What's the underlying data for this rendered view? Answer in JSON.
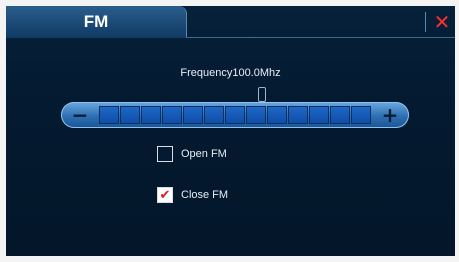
{
  "tab": {
    "title": "FM"
  },
  "window": {
    "close_glyph": "✕"
  },
  "frequency": {
    "label": "Frequency100.0Mhz",
    "value_mhz": 100.0
  },
  "slider": {
    "minus_glyph": "−",
    "plus_glyph": "+",
    "segments": 13,
    "icons": [
      "minus-icon",
      "plus-icon"
    ]
  },
  "options": [
    {
      "label": "Open FM",
      "checked": false
    },
    {
      "label": "Close FM",
      "checked": true
    }
  ],
  "colors": {
    "accent": "#2d6fb2",
    "close": "#ff2d2d",
    "check": "#e01b1b"
  }
}
